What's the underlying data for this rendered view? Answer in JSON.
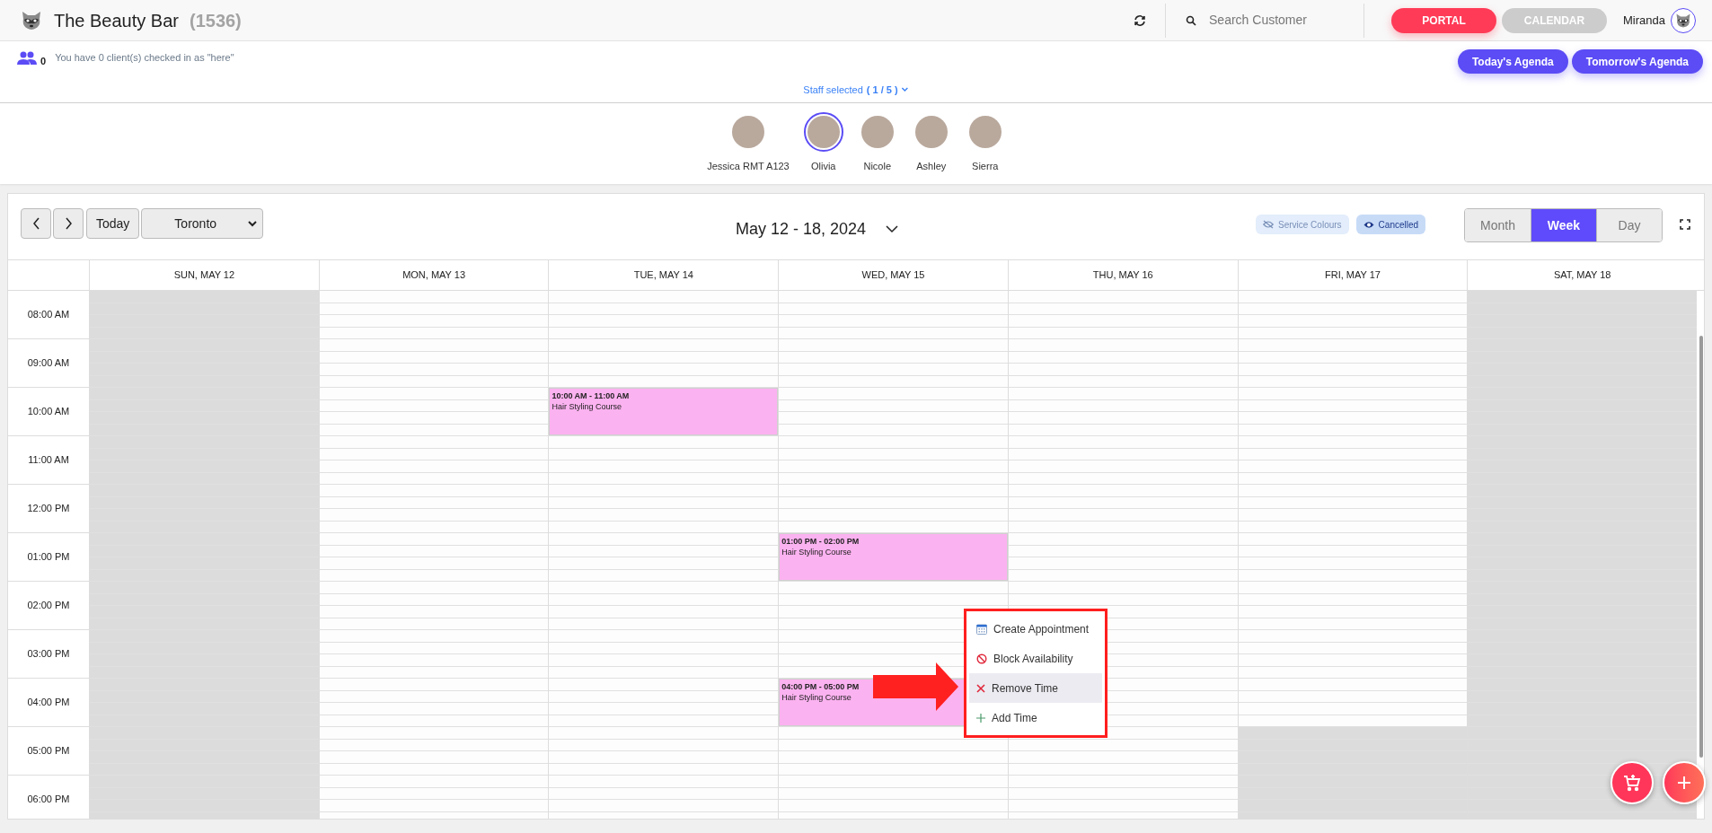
{
  "app": {
    "title": "The Beauty Bar",
    "count": "(1536)"
  },
  "header": {
    "search_placeholder": "Search Customer",
    "nav": [
      {
        "label": "PORTAL",
        "selected": true
      },
      {
        "label": "CALENDAR",
        "selected": false
      }
    ],
    "user": "Miranda"
  },
  "checkin": {
    "count": "0",
    "message": "You have 0 client(s) checked in as \"here\""
  },
  "agenda_buttons": [
    "Today's Agenda",
    "Tomorrow's Agenda"
  ],
  "staff_selected": {
    "label": "Staff selected",
    "count": "( 1 / 5 )"
  },
  "staff": [
    {
      "name": "Jessica RMT A123",
      "selected": false
    },
    {
      "name": "Olivia",
      "selected": true
    },
    {
      "name": "Nicole",
      "selected": false
    },
    {
      "name": "Ashley",
      "selected": false
    },
    {
      "name": "Sierra",
      "selected": false
    }
  ],
  "toolbar": {
    "today": "Today",
    "location": "Toronto",
    "range": "May 12 - 18, 2024",
    "toggles": [
      {
        "label": "Service Colours",
        "on": false
      },
      {
        "label": "Cancelled",
        "on": true
      }
    ],
    "views": [
      {
        "label": "Month",
        "selected": false
      },
      {
        "label": "Week",
        "selected": true
      },
      {
        "label": "Day",
        "selected": false
      }
    ]
  },
  "days": [
    "SUN, MAY 12",
    "MON, MAY 13",
    "TUE, MAY 14",
    "WED, MAY 15",
    "THU, MAY 16",
    "FRI, MAY 17",
    "SAT, MAY 18"
  ],
  "rows": [
    {
      "time": "08:00 AM",
      "cells": [
        {
          "unavailable": true
        },
        {
          "unavailable": false
        },
        {
          "unavailable": false
        },
        {
          "unavailable": false
        },
        {
          "unavailable": false
        },
        {
          "unavailable": false
        },
        {
          "unavailable": true
        }
      ]
    },
    {
      "time": "09:00 AM",
      "cells": [
        {
          "unavailable": true
        },
        {
          "unavailable": false
        },
        {
          "unavailable": false
        },
        {
          "unavailable": false
        },
        {
          "unavailable": false
        },
        {
          "unavailable": false
        },
        {
          "unavailable": true
        }
      ]
    },
    {
      "time": "10:00 AM",
      "cells": [
        {
          "unavailable": true
        },
        {
          "unavailable": false
        },
        {
          "event": {
            "time": "10:00 AM - 11:00 AM",
            "title": "Hair Styling Course"
          }
        },
        {
          "unavailable": false
        },
        {
          "unavailable": false
        },
        {
          "unavailable": false
        },
        {
          "unavailable": true
        }
      ]
    },
    {
      "time": "11:00 AM",
      "cells": [
        {
          "unavailable": true
        },
        {
          "unavailable": false
        },
        {
          "unavailable": false
        },
        {
          "unavailable": false
        },
        {
          "unavailable": false
        },
        {
          "unavailable": false
        },
        {
          "unavailable": true
        }
      ]
    },
    {
      "time": "12:00 PM",
      "cells": [
        {
          "unavailable": true
        },
        {
          "unavailable": false
        },
        {
          "unavailable": false
        },
        {
          "unavailable": false
        },
        {
          "unavailable": false
        },
        {
          "unavailable": false
        },
        {
          "unavailable": true
        }
      ]
    },
    {
      "time": "01:00 PM",
      "cells": [
        {
          "unavailable": true
        },
        {
          "unavailable": false
        },
        {
          "unavailable": false
        },
        {
          "event": {
            "time": "01:00 PM - 02:00 PM",
            "title": "Hair Styling Course"
          }
        },
        {
          "unavailable": false
        },
        {
          "unavailable": false
        },
        {
          "unavailable": true
        }
      ]
    },
    {
      "time": "02:00 PM",
      "cells": [
        {
          "unavailable": true
        },
        {
          "unavailable": false
        },
        {
          "unavailable": false
        },
        {
          "unavailable": false
        },
        {
          "unavailable": false
        },
        {
          "unavailable": false
        },
        {
          "unavailable": true
        }
      ]
    },
    {
      "time": "03:00 PM",
      "cells": [
        {
          "unavailable": true
        },
        {
          "unavailable": false
        },
        {
          "unavailable": false
        },
        {
          "unavailable": false
        },
        {
          "unavailable": false
        },
        {
          "unavailable": false
        },
        {
          "unavailable": true
        }
      ]
    },
    {
      "time": "04:00 PM",
      "cells": [
        {
          "unavailable": true
        },
        {
          "unavailable": false
        },
        {
          "unavailable": false
        },
        {
          "event": {
            "time": "04:00 PM - 05:00 PM",
            "title": "Hair Styling Course"
          }
        },
        {
          "unavailable": false
        },
        {
          "unavailable": false
        },
        {
          "unavailable": true
        }
      ]
    },
    {
      "time": "05:00 PM",
      "cells": [
        {
          "unavailable": true
        },
        {
          "unavailable": false
        },
        {
          "unavailable": false
        },
        {
          "unavailable": false
        },
        {
          "unavailable": false
        },
        {
          "unavailable": true
        },
        {
          "unavailable": true
        }
      ]
    },
    {
      "time": "06:00 PM",
      "cells": [
        {
          "unavailable": true
        },
        {
          "unavailable": false
        },
        {
          "unavailable": false
        },
        {
          "unavailable": false
        },
        {
          "unavailable": false
        },
        {
          "unavailable": true
        },
        {
          "unavailable": true
        }
      ]
    }
  ],
  "context_menu": {
    "items": [
      {
        "kind": "create",
        "label": "Create Appointment",
        "selected": false
      },
      {
        "kind": "block",
        "label": "Block Availability",
        "selected": false
      },
      {
        "kind": "remove",
        "label": "Remove Time",
        "selected": true
      },
      {
        "kind": "add",
        "label": "Add Time",
        "selected": false
      }
    ]
  }
}
